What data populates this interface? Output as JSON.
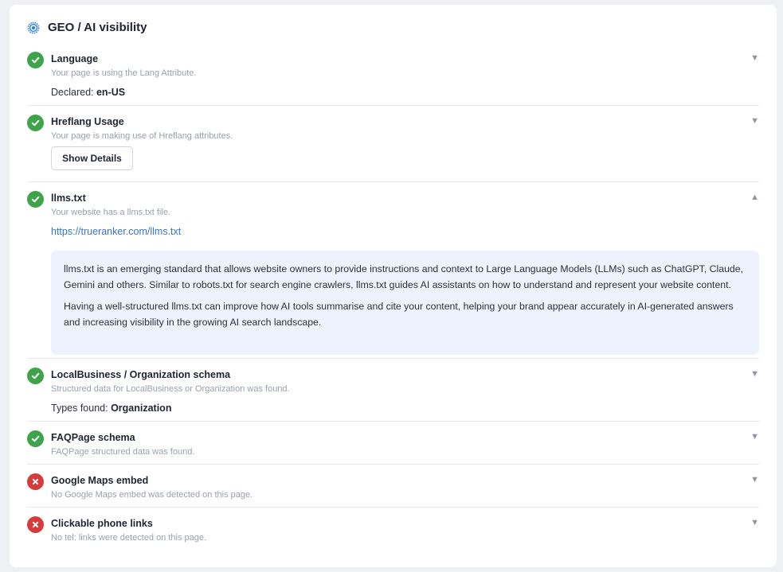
{
  "section": {
    "title": "GEO / AI visibility",
    "icon": "chip-icon"
  },
  "colors": {
    "pass": "#3ea34a",
    "fail": "#d63b3b",
    "link": "#3a74c6",
    "info_bg": "#edf2fd"
  },
  "items": [
    {
      "status": "pass",
      "title": "Language",
      "desc": "Your page is using the Lang Attribute.",
      "extra_label": "Declared: ",
      "extra_value": "en-US",
      "expanded": false
    },
    {
      "status": "pass",
      "title": "Hreflang Usage",
      "desc": "Your page is making use of Hreflang attributes.",
      "button_label": "Show Details",
      "expanded": false
    },
    {
      "status": "pass",
      "title": "llms.txt",
      "desc": "Your website has a llms.txt file.",
      "link": "https://trueranker.com/llms.txt",
      "info_p1": "llms.txt is an emerging standard that allows website owners to provide instructions and context to Large Language Models (LLMs) such as ChatGPT, Claude, Gemini and others. Similar to robots.txt for search engine crawlers, llms.txt guides AI assistants on how to understand and represent your website content.",
      "info_p2": "Having a well-structured llms.txt can improve how AI tools summarise and cite your content, helping your brand appear accurately in AI-generated answers and increasing visibility in the growing AI search landscape.",
      "expanded": true
    },
    {
      "status": "pass",
      "title": "LocalBusiness / Organization schema",
      "desc": "Structured data for LocalBusiness or Organization was found.",
      "extra_label": "Types found: ",
      "extra_value": "Organization",
      "expanded": false
    },
    {
      "status": "pass",
      "title": "FAQPage schema",
      "desc": "FAQPage structured data was found.",
      "expanded": false
    },
    {
      "status": "fail",
      "title": "Google Maps embed",
      "desc": "No Google Maps embed was detected on this page.",
      "expanded": false
    },
    {
      "status": "fail",
      "title": "Clickable phone links",
      "desc": "No tel: links were detected on this page.",
      "expanded": false
    }
  ],
  "chevrons": {
    "collapsed": "▼",
    "expanded": "▲"
  }
}
